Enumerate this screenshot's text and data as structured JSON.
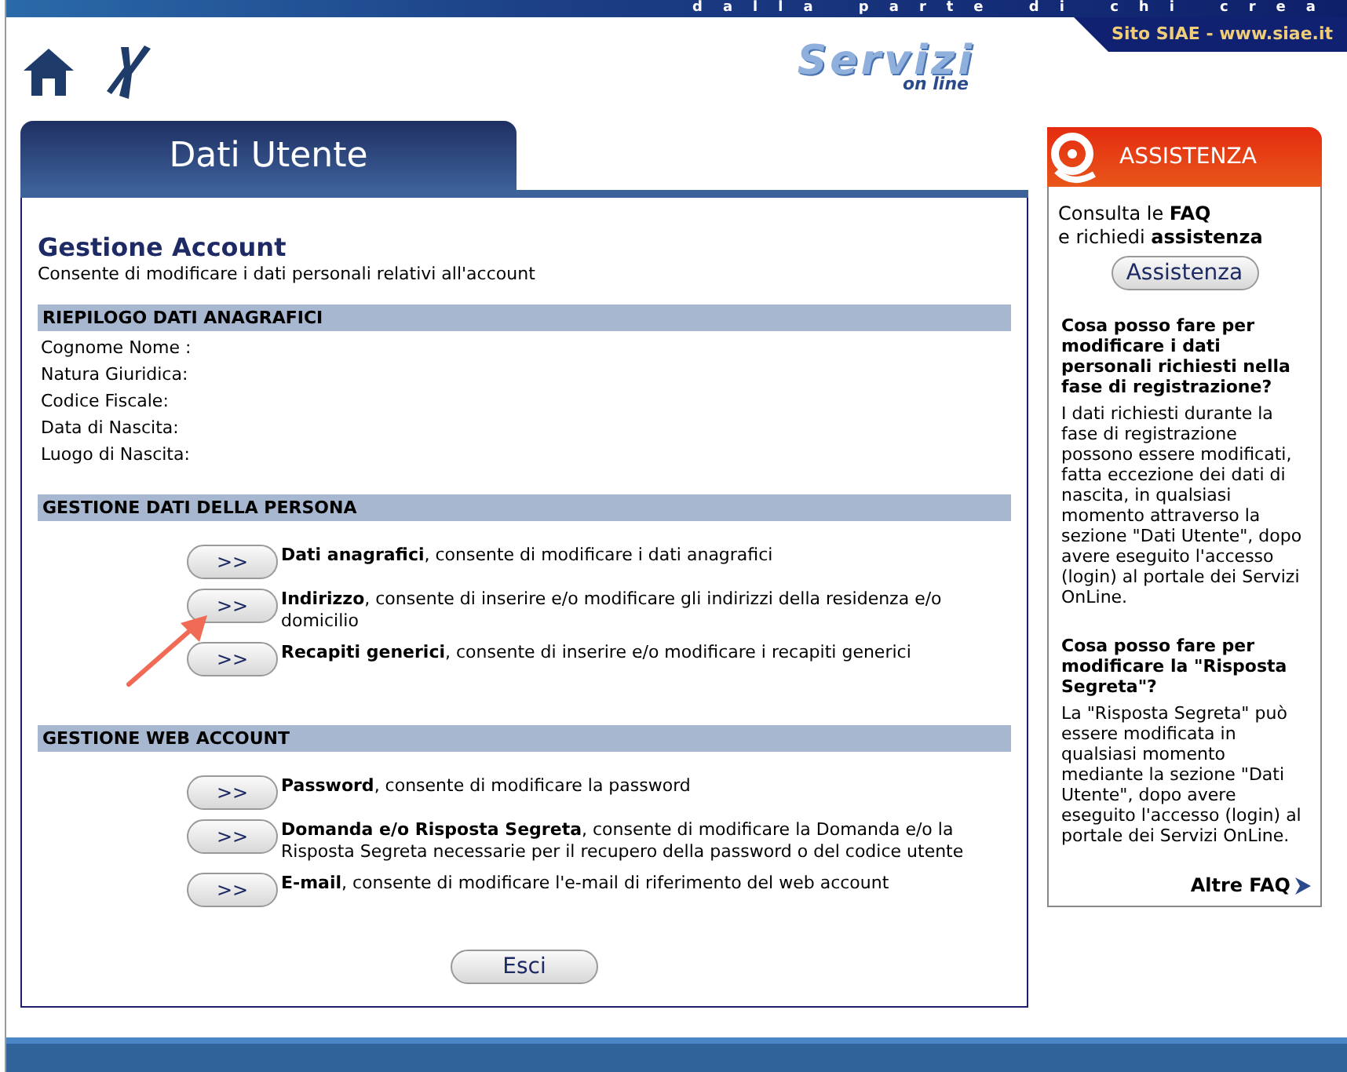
{
  "topbar": {
    "tagline": "dalla parte di chi crea",
    "site_link": "Sito SIAE - www.siae.it"
  },
  "logo": {
    "main": "Servizi",
    "sub": "on line"
  },
  "tab": "Dati Utente",
  "account": {
    "title": "Gestione Account",
    "subtitle": "Consente di modificare i dati personali relativi all'account"
  },
  "summary": {
    "heading": "RIEPILOGO DATI ANAGRAFICI",
    "fields": [
      "Cognome Nome :",
      "Natura Giuridica:",
      "Codice Fiscale:",
      "Data di Nascita:",
      "Luogo di Nascita:"
    ]
  },
  "groups": [
    {
      "heading": "GESTIONE DATI DELLA PERSONA",
      "actions": [
        {
          "button": ">>",
          "text": "**Dati anagrafici**, consente di modificare i dati anagrafici"
        },
        {
          "button": ">>",
          "text": "**Indirizzo**, consente di inserire e/o modificare gli indirizzi della residenza e/o domicilio"
        },
        {
          "button": ">>",
          "text": "**Recapiti generici**, consente di inserire e/o modificare i recapiti generici"
        }
      ]
    },
    {
      "heading": "GESTIONE WEB ACCOUNT",
      "actions": [
        {
          "button": ">>",
          "text": "**Password**, consente di modificare la password"
        },
        {
          "button": ">>",
          "text": "**Domanda e/o Risposta Segreta**, consente di modificare la Domanda e/o la Risposta Segreta necessarie per il recupero della password o del codice utente"
        },
        {
          "button": ">>",
          "text": "**E-mail**, consente di modificare l'e-mail di riferimento del web account"
        }
      ]
    }
  ],
  "exit_button": "Esci",
  "sidebar": {
    "title": "ASSISTENZA",
    "intro": [
      "Consulta le **FAQ**",
      "e richiedi **assistenza**"
    ],
    "button": "Assistenza",
    "faqs": [
      {
        "question": "Cosa posso fare per modificare i dati personali richiesti nella fase di registrazione?",
        "answer": "I dati richiesti durante la fase di registrazione possono essere modificati, fatta eccezione dei dati di nascita, in qualsiasi momento attraverso la sezione \"Dati Utente\", dopo avere eseguito l'accesso (login) al portale dei Servizi OnLine."
      },
      {
        "question": "Cosa posso fare per modificare la \"Risposta Segreta\"?",
        "answer": "La \"Risposta Segreta\" può essere modificata in qualsiasi momento mediante la sezione \"Dati Utente\", dopo avere eseguito l'accesso (login) al portale dei Servizi OnLine."
      }
    ],
    "more_link": "Altre FAQ"
  }
}
